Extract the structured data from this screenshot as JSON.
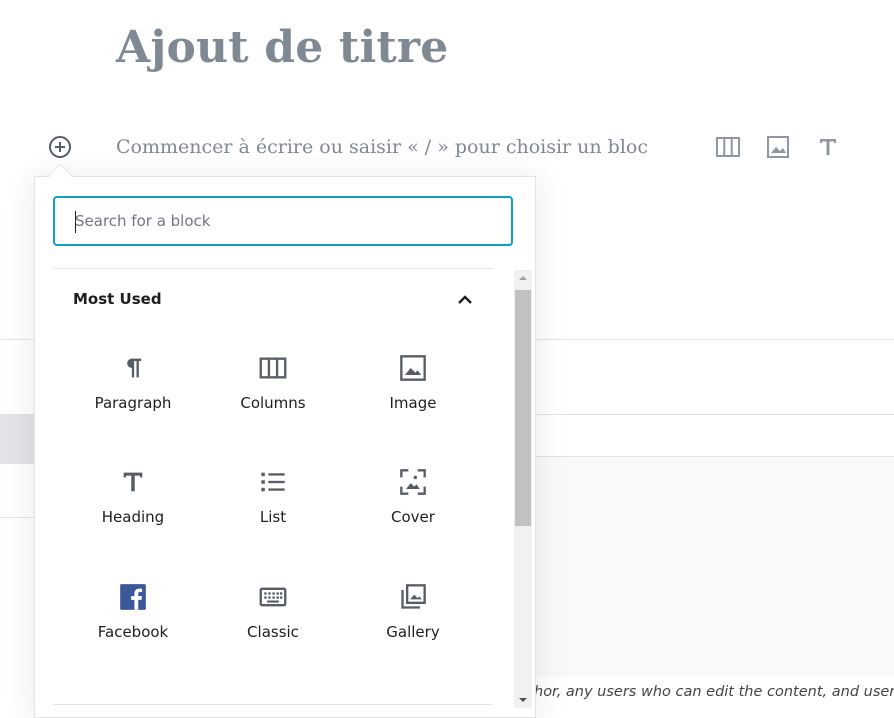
{
  "editor": {
    "title_placeholder": "Ajout de titre",
    "block_placeholder": "Commencer à écrire ou saisir « / » pour choisir un bloc"
  },
  "inserter": {
    "search_placeholder": "Search for a block",
    "section_title": "Most Used",
    "blocks": [
      {
        "label": "Paragraph",
        "icon": "paragraph-icon"
      },
      {
        "label": "Columns",
        "icon": "columns-icon"
      },
      {
        "label": "Image",
        "icon": "image-icon"
      },
      {
        "label": "Heading",
        "icon": "heading-icon"
      },
      {
        "label": "List",
        "icon": "list-icon"
      },
      {
        "label": "Cover",
        "icon": "cover-icon"
      },
      {
        "label": "Facebook",
        "icon": "facebook-icon"
      },
      {
        "label": "Classic",
        "icon": "keyboard-icon"
      },
      {
        "label": "Gallery",
        "icon": "gallery-icon"
      }
    ]
  },
  "background": {
    "footer_text": "hor, any users who can edit the content, and users w"
  },
  "colors": {
    "accent": "#0f9fc2",
    "facebook": "#3b5998",
    "muted": "#7e8993"
  }
}
